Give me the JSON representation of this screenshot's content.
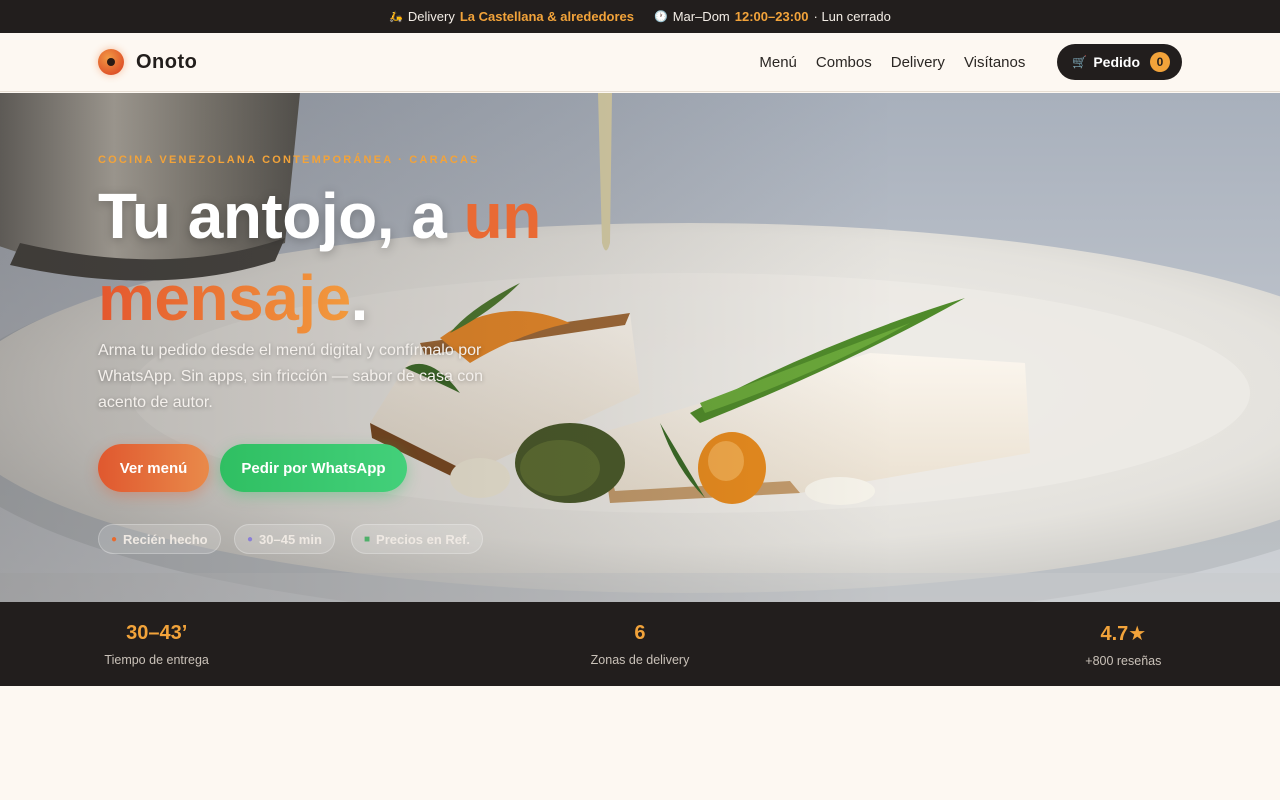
{
  "topbar": {
    "delivery_icon": "scooter-icon",
    "delivery_prefix": "Delivery",
    "delivery_area": "La Castellana & alrededores",
    "clock_icon": "clock-icon",
    "hours_days": "Mar–Dom",
    "hours_time": "12:00–23:00",
    "hours_note": "· Lun cerrado"
  },
  "brand": {
    "name": "Onoto"
  },
  "nav": {
    "items": [
      "Menú",
      "Combos",
      "Delivery",
      "Visítanos"
    ],
    "order_label": "Pedido",
    "order_count": "0",
    "cart_icon": "cart-icon"
  },
  "hero": {
    "eyebrow": "COCINA VENEZOLANA CONTEMPORÁNEA · CARACAS",
    "title_part1": "Tu antojo, a ",
    "title_accent1": "un",
    "title_accent2": "mensaje",
    "title_end": ".",
    "lede": "Arma tu pedido desde el menú digital y confírmalo por WhatsApp. Sin apps, sin fricción — sabor de casa con acento de autor.",
    "cta_menu": "Ver menú",
    "cta_whatsapp": "Pedir por WhatsApp",
    "chips": [
      {
        "icon": "flame-icon",
        "label": "Recién hecho"
      },
      {
        "icon": "timer-icon",
        "label": "30–45 min"
      },
      {
        "icon": "cash-icon",
        "label": "Precios en Ref."
      }
    ]
  },
  "stats": [
    {
      "value": "30–43’",
      "label": "Tiempo de entrega"
    },
    {
      "value": "6",
      "label": "Zonas de delivery"
    },
    {
      "value": "4.7★",
      "label": "+800 reseñas"
    }
  ],
  "colors": {
    "accent_orange": "#f2a33a",
    "accent_red": "#e0582f",
    "whatsapp_green": "#2fbf62",
    "dark": "#221e1d",
    "cream": "#fdf8f2"
  }
}
